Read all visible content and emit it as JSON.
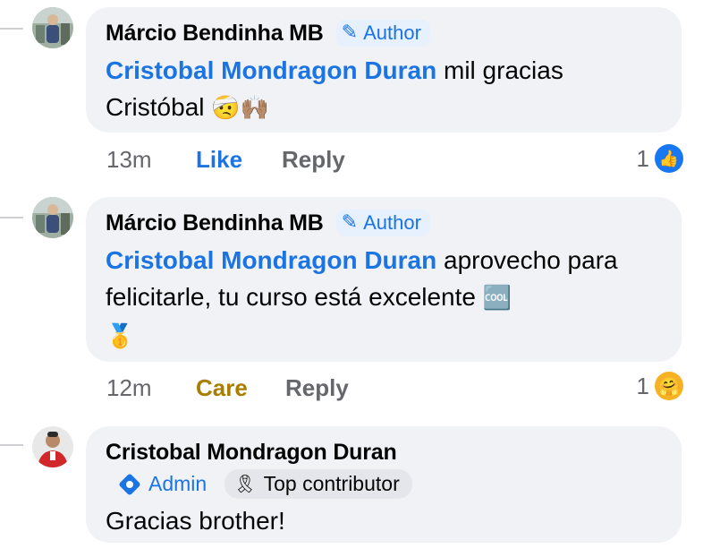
{
  "comments": [
    {
      "author": "Márcio Bendinha MB",
      "badge": "Author",
      "mention": "Cristobal Mondragon Duran",
      "text": " mil gracias Cristóbal",
      "emojis": "🤕🙌🏽",
      "time": "13m",
      "reaction_action": "Like",
      "reply": "Reply",
      "reaction_count": "1",
      "reaction_type": "like"
    },
    {
      "author": "Márcio Bendinha MB",
      "badge": "Author",
      "mention": "Cristobal Mondragon Duran",
      "text": " aprovecho para felicitarle, tu curso está excelente",
      "emojis": "🆒",
      "emoji_line2": "🥇",
      "time": "12m",
      "reaction_action": "Care",
      "reply": "Reply",
      "reaction_count": "1",
      "reaction_type": "care"
    },
    {
      "author": "Cristobal Mondragon Duran",
      "admin_badge": "Admin",
      "top_badge": "Top contributor",
      "text": "Gracias brother!"
    }
  ],
  "colors": {
    "link_blue": "#1b74e4",
    "care_gold": "#a87e00",
    "bubble_bg": "#f0f2f5",
    "meta_gray": "#65676b"
  },
  "icons": {
    "author_badge": "pencil-icon",
    "admin_badge": "shield-diamond-icon",
    "top_contributor": "ribbon-icon",
    "like_reaction": "thumbs-up-icon",
    "care_reaction": "care-hug-icon"
  }
}
